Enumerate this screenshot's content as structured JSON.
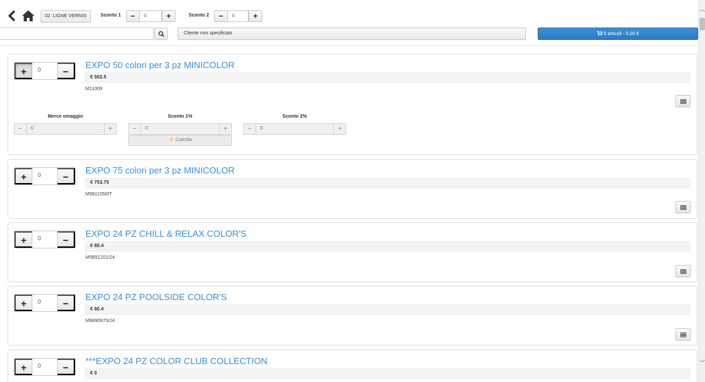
{
  "toolbar": {
    "category_label": "02. LIGNE VERNIS",
    "sconto1": {
      "label": "Sconto 1",
      "value": "0"
    },
    "sconto2": {
      "label": "Sconto 2",
      "value": "0"
    },
    "search": {
      "value": "",
      "placeholder": ""
    },
    "cliente_label": "Cliente non specificato",
    "cart_label": "0 articoli - 0.00 €"
  },
  "products": [
    {
      "qty": "0",
      "title": "EXPO 50 colori per 3 pz MINICOLOR",
      "price": "€ 502.5",
      "code": "M11009",
      "expanded": true,
      "discounts": {
        "merce_omaggio": {
          "label": "Merce omaggio",
          "value": "0"
        },
        "sconto1": {
          "label": "Sconto 1%",
          "value": "0"
        },
        "sconto2": {
          "label": "Sconto 2%",
          "value": "0"
        },
        "calcola_label": "Calcola"
      }
    },
    {
      "qty": "0",
      "title": "EXPO 75 colori per 3 pz MINICOLOR",
      "price": "€ 753.75",
      "code": "M9811050IT"
    },
    {
      "qty": "0",
      "title": "EXPO 24 PZ CHILL & RELAX COLOR'S",
      "price": "€ 80.4",
      "code": "M9891201/24"
    },
    {
      "qty": "0",
      "title": "EXPO 24 PZ POOLSIDE COLOR'S",
      "price": "€ 80.4",
      "code": "M9890975/24"
    },
    {
      "qty": "0",
      "title": "***EXPO 24 PZ COLOR CLUB COLLECTION",
      "price": "€ 0",
      "code": ""
    }
  ],
  "colors": {
    "accent": "#3a8fd6",
    "cart_bg": "#2c7bc2"
  }
}
